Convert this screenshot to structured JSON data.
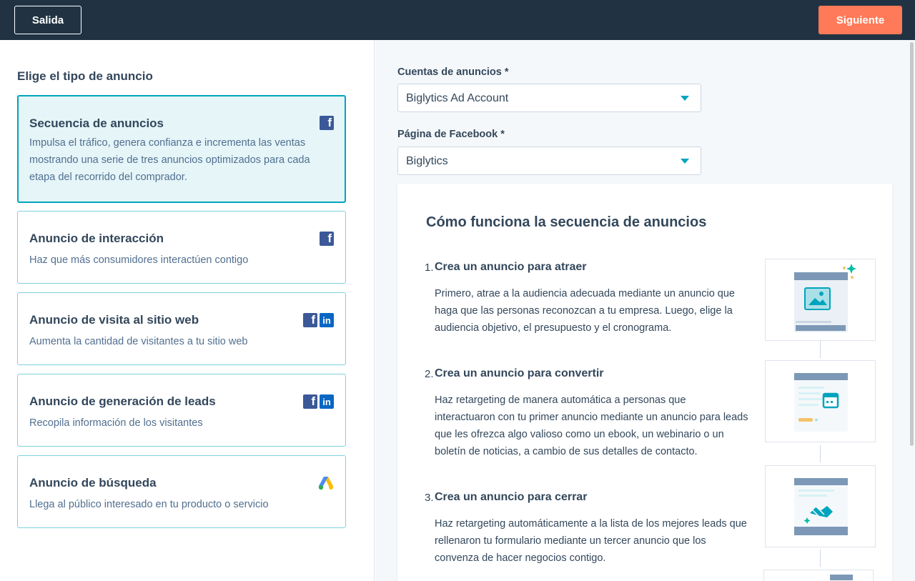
{
  "header": {
    "exit_label": "Salida",
    "next_label": "Siguiente"
  },
  "left": {
    "title": "Elige el tipo de anuncio",
    "cards": [
      {
        "title": "Secuencia de anuncios",
        "description": "Impulsa el tráfico, genera confianza e incrementa las ventas mostrando una serie de tres anuncios optimizados para cada etapa del recorrido del comprador.",
        "icons": [
          "facebook-icon"
        ],
        "selected": true
      },
      {
        "title": "Anuncio de interacción",
        "description": "Haz que más consumidores interactúen contigo",
        "icons": [
          "facebook-icon"
        ]
      },
      {
        "title": "Anuncio de visita al sitio web",
        "description": "Aumenta la cantidad de visitantes a tu sitio web",
        "icons": [
          "facebook-icon",
          "linkedin-icon"
        ]
      },
      {
        "title": "Anuncio de generación de leads",
        "description": "Recopila información de los visitantes",
        "icons": [
          "facebook-icon",
          "linkedin-icon"
        ]
      },
      {
        "title": "Anuncio de búsqueda",
        "description": "Llega al público interesado en tu producto o servicio",
        "icons": [
          "google-ads-icon"
        ]
      }
    ]
  },
  "form": {
    "ad_account_label": "Cuentas de anuncios *",
    "ad_account_value": "Biglytics Ad Account",
    "fb_page_label": "Página de Facebook *",
    "fb_page_value": "Biglytics"
  },
  "panel": {
    "title": "Cómo funciona la secuencia de anuncios",
    "steps": [
      {
        "num": "1.",
        "title": "Crea un anuncio para atraer",
        "desc": "Primero, atrae a la audiencia adecuada mediante un anuncio que haga que las personas reconozcan a tu empresa. Luego, elige la audiencia objetivo, el presupuesto y el cronograma."
      },
      {
        "num": "2.",
        "title": "Crea un anuncio para convertir",
        "desc": "Haz retargeting de manera automática a personas que interactuaron con tu primer anuncio mediante un anuncio para leads que les ofrezca algo valioso como un ebook, un webinario o un boletín de noticias, a cambio de sus detalles de contacto."
      },
      {
        "num": "3.",
        "title": "Crea un anuncio para cerrar",
        "desc": "Haz retargeting automáticamente a la lista de los mejores leads que rellenaron tu formulario mediante un tercer anuncio que los convenza de hacer negocios contigo."
      }
    ]
  },
  "colors": {
    "topbar": "#213343",
    "accent": "#ff7a59",
    "teal": "#00a4bd",
    "facebook": "#3b5998",
    "linkedin": "#0a66c2"
  }
}
